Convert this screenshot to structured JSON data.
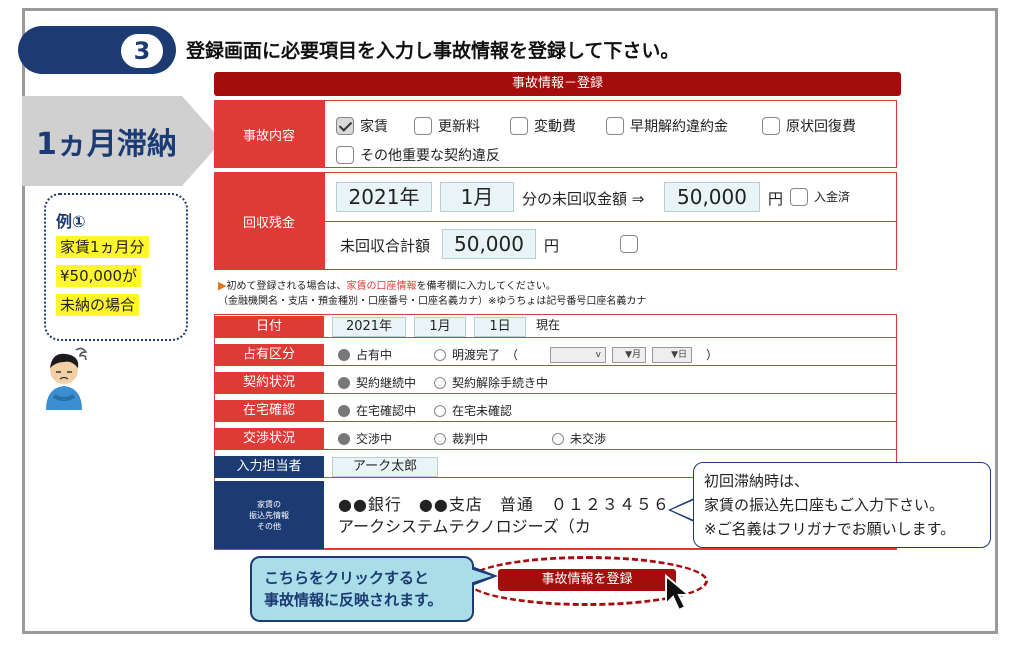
{
  "header": {
    "step_number": "3",
    "instruction": "登録画面に必要項目を入力し事故情報を登録して下さい。"
  },
  "sidebar": {
    "banner": "1ヵ月滞納",
    "example_title": "例①",
    "example_lines": [
      "家賃1ヵ月分",
      "¥50,000が",
      "未納の場合"
    ]
  },
  "form": {
    "title": "事故情報－登録",
    "incident": {
      "label": "事故内容",
      "options": [
        {
          "label": "家賃",
          "checked": true
        },
        {
          "label": "更新料",
          "checked": false
        },
        {
          "label": "変動費",
          "checked": false
        },
        {
          "label": "早期解約違約金",
          "checked": false
        },
        {
          "label": "原状回復費",
          "checked": false
        },
        {
          "label": "その他重要な契約違反",
          "checked": false
        }
      ]
    },
    "balance": {
      "label": "回収残金",
      "year": "2021年",
      "month": "1月",
      "mid_text": "分の未回収金額 ⇒",
      "amount": "50,000",
      "unit": "円",
      "paid_label": "入金済",
      "total_label": "未回収合計額",
      "total_amount": "50,000",
      "total_unit": "円"
    },
    "note": {
      "line1_a": "初めて登録される場合は、",
      "line1_highlight": "家賃の口座情報",
      "line1_b": "を備考欄に入力してください。",
      "line2": "（金融機関名・支店・預金種別・口座番号・口座名義カナ）※ゆうちょは記号番号口座名義カナ"
    },
    "date": {
      "label": "日付",
      "year": "2021年",
      "month": "1月",
      "day": "1日",
      "suffix": "現在"
    },
    "occupancy": {
      "label": "占有区分",
      "opt1": "占有中",
      "opt2": "明渡完了　（",
      "sel1": "v",
      "sel2": "▼月",
      "sel3": "▼日",
      "close": "）"
    },
    "contract": {
      "label": "契約状況",
      "opt1": "契約継続中",
      "opt2": "契約解除手続き中"
    },
    "residence": {
      "label": "在宅確認",
      "opt1": "在宅確認中",
      "opt2": "在宅未確認"
    },
    "negotiation": {
      "label": "交渉状況",
      "opt1": "交渉中",
      "opt2": "裁判中",
      "opt3": "未交渉"
    },
    "operator": {
      "label": "入力担当者",
      "value": "アーク太郎"
    },
    "bank": {
      "label_lines": [
        "家賃の",
        "振込先情報",
        "その他"
      ],
      "line1": "●●銀行　●●支店　普通　０１２３４５６",
      "line2": "アークシステムテクノロジーズ（カ"
    },
    "register_button": "事故情報を登録"
  },
  "callouts": {
    "right_lines": [
      "初回滞納時は、",
      "家賃の振込先口座もご入力下さい。",
      "※ご名義はフリガナでお願いします。"
    ],
    "left_lines": [
      "こちらをクリックすると",
      "事故情報に反映されます。"
    ]
  },
  "colors": {
    "navy": "#1d3b73",
    "dark_red": "#a50d0d",
    "red": "#e03a36",
    "highlight_yellow": "#fff62b",
    "light_blue": "#a9dde8"
  }
}
